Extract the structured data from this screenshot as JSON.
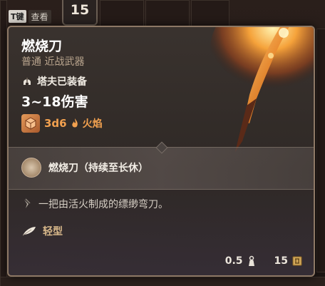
{
  "hud": {
    "key_cap": "T键",
    "key_label": "查看",
    "level": "15"
  },
  "item": {
    "name": "燃烧刀",
    "rarity_type": "普通 近战武器",
    "equipped_by": "塔夫已装备",
    "damage": "3~18伤害",
    "dice": "3d6",
    "damage_type": "火焰",
    "action": "燃烧刀（持续至长休）",
    "description": "一把由活火制成的缥缈弯刀。",
    "weight_class": "轻型",
    "weight": "0.5",
    "value": "15"
  },
  "icons": {
    "equipped": "helmet-icon",
    "dice": "dice-icon",
    "fire": "flame-icon",
    "action": "flame-blade-action-icon",
    "description": "flavor-quill-icon",
    "weight_class": "feather-icon",
    "weight": "weight-icon",
    "value": "gold-coin-icon"
  },
  "colors": {
    "accent_orange": "#f2a14f",
    "title": "#ffffff",
    "subtitle": "#b9a58e",
    "light_type": "#d9b98b",
    "border": "#8d7865"
  }
}
